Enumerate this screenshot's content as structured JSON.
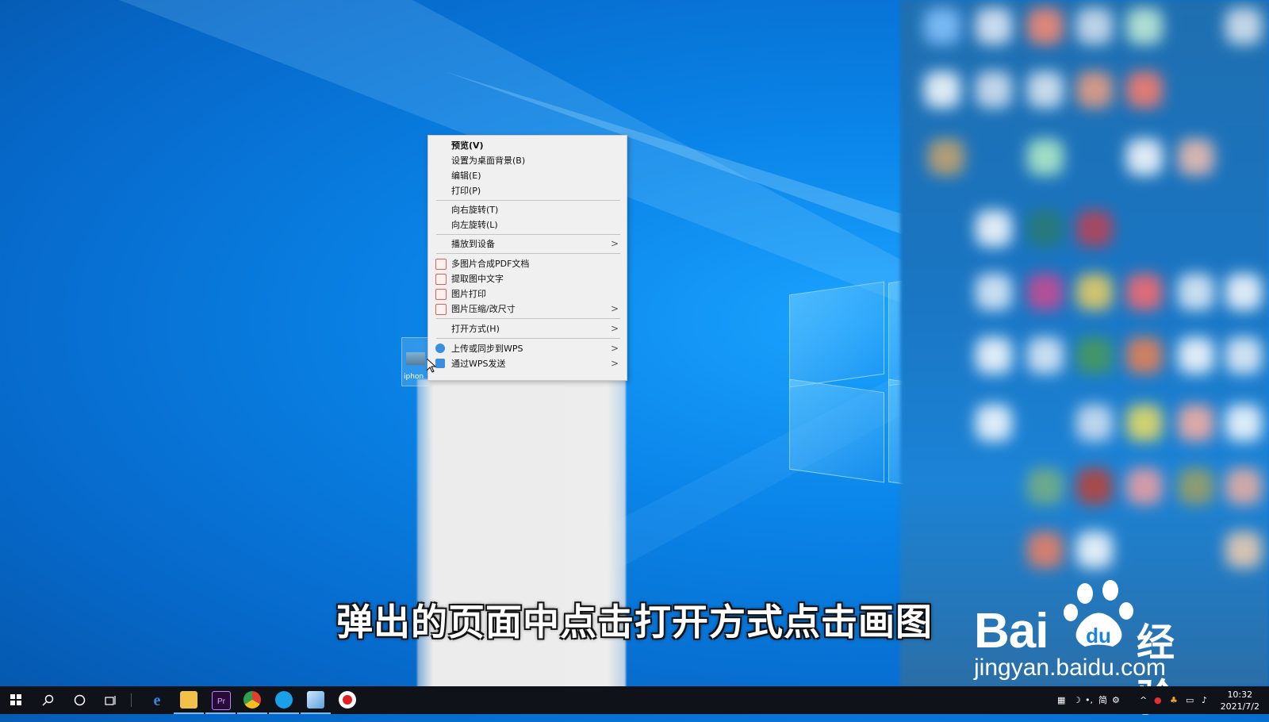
{
  "desktop": {
    "icon_label": "iphon"
  },
  "menu": {
    "items": [
      {
        "label": "预览(V)"
      },
      {
        "label": "设置为桌面背景(B)"
      },
      {
        "label": "编辑(E)"
      },
      {
        "label": "打印(P)"
      },
      {
        "label": "向右旋转(T)"
      },
      {
        "label": "向左旋转(L)"
      },
      {
        "label": "播放到设备"
      },
      {
        "label": "多图片合成PDF文档"
      },
      {
        "label": "提取图中文字"
      },
      {
        "label": "图片打印"
      },
      {
        "label": "图片压缩/改尺寸"
      },
      {
        "label": "打开方式(H)"
      },
      {
        "label": "上传或同步到WPS"
      },
      {
        "label": "通过WPS发送"
      }
    ],
    "submenu_arrow": ">"
  },
  "subtitle": "弹出的页面中点击打开方式点击画图",
  "watermark": {
    "brand_left": "Bai",
    "brand_mid": "du",
    "brand_right": "经验",
    "url": "jingyan.baidu.com"
  },
  "taskbar": {
    "tray_ime": "简",
    "clock_time": "10:32",
    "clock_date": "2021/7/2"
  },
  "colors": {
    "menu_bg": "#f0f0f0",
    "taskbar_bg": "#10121a",
    "desktop_blue": "#0a84e8"
  }
}
